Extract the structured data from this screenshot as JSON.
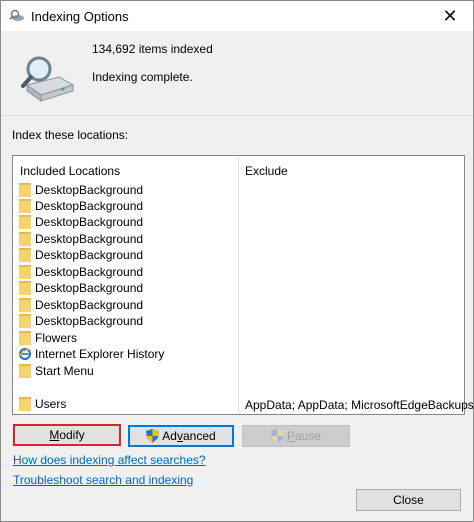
{
  "window": {
    "title": "Indexing Options",
    "close_glyph": "✕"
  },
  "stats": {
    "items_indexed": "134,692 items indexed",
    "status": "Indexing complete."
  },
  "locations": {
    "section_label": "Index these locations:",
    "col_included": "Included Locations",
    "col_exclude": "Exclude",
    "rows": [
      {
        "label": "DesktopBackground",
        "icon": "folder-icon"
      },
      {
        "label": "DesktopBackground",
        "icon": "folder-icon"
      },
      {
        "label": "DesktopBackground",
        "icon": "folder-icon"
      },
      {
        "label": "DesktopBackground",
        "icon": "folder-icon"
      },
      {
        "label": "DesktopBackground",
        "icon": "folder-icon"
      },
      {
        "label": "DesktopBackground",
        "icon": "folder-icon"
      },
      {
        "label": "DesktopBackground",
        "icon": "folder-icon"
      },
      {
        "label": "DesktopBackground",
        "icon": "folder-icon"
      },
      {
        "label": "DesktopBackground",
        "icon": "folder-icon"
      },
      {
        "label": "Flowers",
        "icon": "folder-icon"
      },
      {
        "label": "Internet Explorer History",
        "icon": "internet-explorer-icon"
      },
      {
        "label": "Start Menu",
        "icon": "folder-icon"
      },
      {
        "label": "Users",
        "icon": "folder-icon"
      }
    ],
    "users_exclude": "AppData; AppData; MicrosoftEdgeBackups"
  },
  "buttons": {
    "modify_pre": "M",
    "modify_rest": "odify",
    "advanced_pre": "Ad",
    "advanced_u": "v",
    "advanced_rest": "anced",
    "pause_u": "P",
    "pause_rest": "ause",
    "close": "Close"
  },
  "links": {
    "how_indexing": "How does indexing affect searches?",
    "troubleshoot": "Troubleshoot search and indexing"
  },
  "colors": {
    "folder": "#f6d36b",
    "highlight_border": "#d9262c",
    "link": "#0066cc",
    "focus_border": "#0078d7"
  }
}
